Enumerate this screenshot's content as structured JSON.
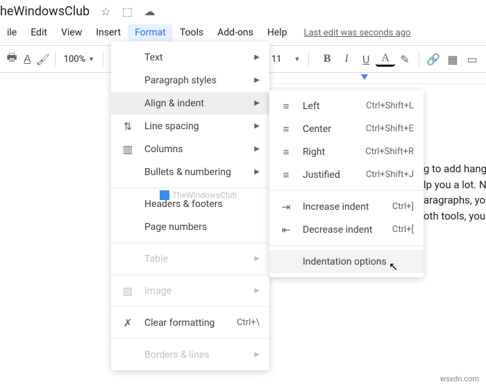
{
  "doc": {
    "title": "heWindowsClub"
  },
  "menubar": {
    "items": [
      "ile",
      "Edit",
      "View",
      "Insert",
      "Format",
      "Tools",
      "Add-ons",
      "Help"
    ],
    "active_index": 4,
    "last_edit": "Last edit was seconds ago"
  },
  "toolbar": {
    "zoom": "100%",
    "font_size": "11"
  },
  "format_menu": {
    "text": "Text",
    "paragraph_styles": "Paragraph styles",
    "align_indent": "Align & indent",
    "line_spacing": "Line spacing",
    "columns": "Columns",
    "bullets_numbering": "Bullets & numbering",
    "headers_footers": "Headers & footers",
    "page_numbers": "Page numbers",
    "table": "Table",
    "image": "Image",
    "clear_formatting": "Clear formatting",
    "clear_formatting_shortcut": "Ctrl+\\",
    "borders_lines": "Borders & lines"
  },
  "align_submenu": {
    "left": {
      "label": "Left",
      "shortcut": "Ctrl+Shift+L"
    },
    "center": {
      "label": "Center",
      "shortcut": "Ctrl+Shift+E"
    },
    "right": {
      "label": "Right",
      "shortcut": "Ctrl+Shift+R"
    },
    "justified": {
      "label": "Justified",
      "shortcut": "Ctrl+Shift+J"
    },
    "increase_indent": {
      "label": "Increase indent",
      "shortcut": "Ctrl+]"
    },
    "decrease_indent": {
      "label": "Decrease indent",
      "shortcut": "Ctrl+["
    },
    "indentation_options": "Indentation options"
  },
  "watermark": "TheWindowsClub",
  "doc_body": {
    "line1": "g to add hang",
    "line2": "lp you a lot. N",
    "line3": "aragraphs, yo",
    "line4": "oth tools, you"
  },
  "footer": "wsxdn.com"
}
